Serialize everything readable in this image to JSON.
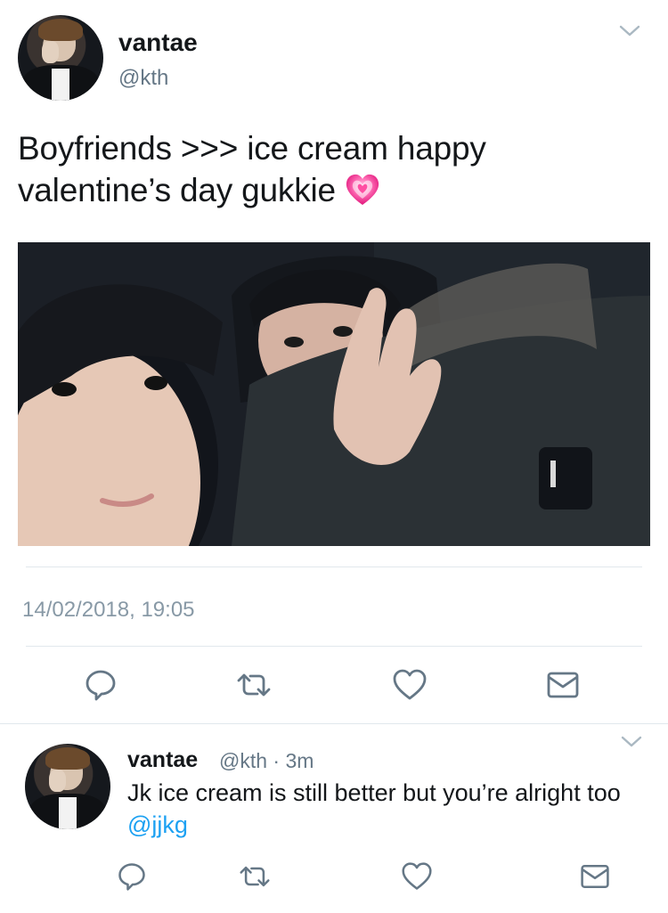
{
  "main_tweet": {
    "display_name": "vantae",
    "handle": "@kth",
    "text": "Boyfriends >>> ice cream happy valentine’s day gukkie",
    "emoji": "growing-heart",
    "timestamp": "14/02/2018, 19:05",
    "photo_alt": "selfie photo"
  },
  "reply_tweet": {
    "display_name": "vantae",
    "handle": "@kth",
    "time": "3m",
    "text": "Jk ice cream is still better but you’re alright too ",
    "mention": "@jjkg"
  },
  "colors": {
    "accent": "#1da1f2",
    "icon": "#657786",
    "divider": "#e1e8ed"
  },
  "icons": [
    "chevron-down-icon",
    "reply-icon",
    "retweet-icon",
    "like-icon",
    "direct-message-icon"
  ]
}
